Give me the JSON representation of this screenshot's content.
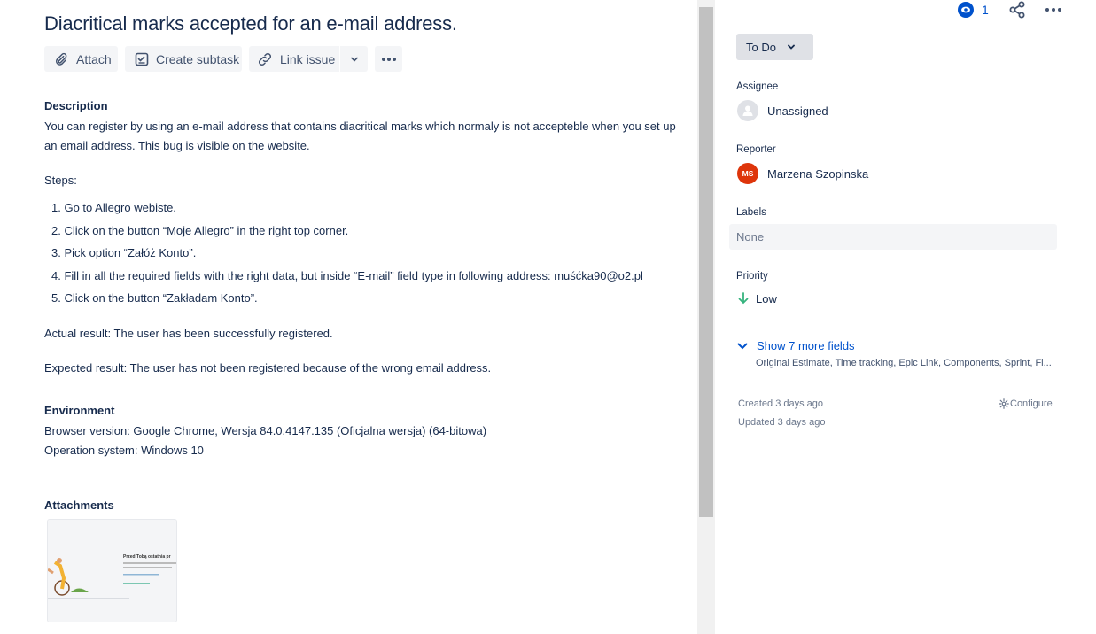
{
  "issue": {
    "title": "Diacritical marks accepted for an e-mail address."
  },
  "toolbar": {
    "attach_label": "Attach",
    "subtask_label": "Create subtask",
    "link_label": "Link issue"
  },
  "description": {
    "heading": "Description",
    "body": "You can register by using an e-mail address that contains diacritical marks which normaly is not accepteble when you set up an email address. This bug is visible on the website.",
    "steps_label": "Steps:",
    "steps": [
      "1. Go to Allegro webiste.",
      "2. Click on the button “Moje Allegro” in the right top corner.",
      "3. Pick option “Załóż Konto”.",
      "4. Fill in all the required fields with the right data, but inside “E-mail” field type in following address: muśćka90@o2.pl",
      "5. Click on the button “Zakładam Konto”."
    ],
    "actual": "Actual result: The user has been successfully registered.",
    "expected": "Expected result: The user has not been registered because of the wrong email address."
  },
  "environment": {
    "heading": "Environment",
    "browser": "Browser version: Google Chrome, Wersja 84.0.4147.135 (Oficjalna wersja) (64-bitowa)",
    "os": "Operation system: Windows 10"
  },
  "attachments": {
    "heading": "Attachments",
    "thumb_text": "Przed Tobą ostatnia pr"
  },
  "side": {
    "watchers_count": "1",
    "status": "To Do",
    "assignee_label": "Assignee",
    "assignee": "Unassigned",
    "reporter_label": "Reporter",
    "reporter": "Marzena Szopinska",
    "reporter_initials": "MS",
    "labels_label": "Labels",
    "labels": "None",
    "priority_label": "Priority",
    "priority": "Low",
    "show_more": "Show 7 more fields",
    "show_more_sub": "Original Estimate, Time tracking, Epic Link, Components, Sprint, Fi...",
    "created": "Created 3 days ago",
    "updated": "Updated 3 days ago",
    "configure": "Configure"
  },
  "colors": {
    "accent": "#0052cc",
    "reporter_avatar": "#de350b",
    "priority_low": "#36b37e"
  }
}
